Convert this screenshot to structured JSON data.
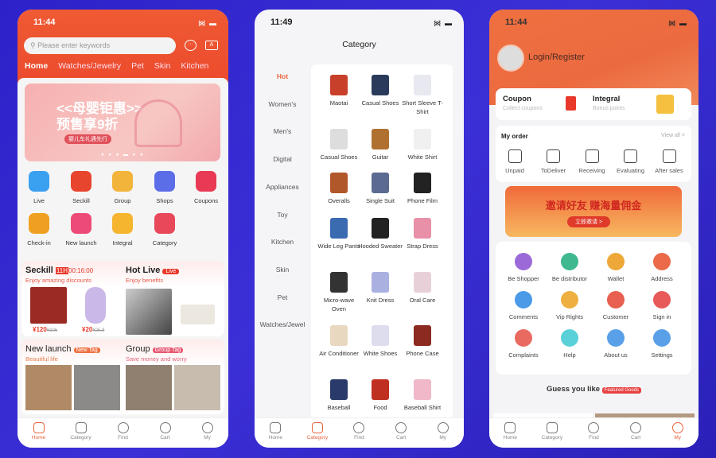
{
  "colors": {
    "accent": "#ee4f2f",
    "background": "#3025c9",
    "active_tab": "#e8643c"
  },
  "tabbar": [
    "Home",
    "Category",
    "Find",
    "Cart",
    "My"
  ],
  "home": {
    "time": "11:44",
    "search_placeholder": "Please enter keywords",
    "nav_tabs": [
      "Home",
      "Watches/Jewelry",
      "Pet",
      "Skin",
      "Kitchen"
    ],
    "banner_text": "<<母婴钜惠>>预售享9折",
    "banner_sub": "婴儿车礼遇先行",
    "shortcuts": [
      {
        "label": "Live",
        "icon": "live-tv-icon",
        "color": "#3aa0f0"
      },
      {
        "label": "Seckill",
        "icon": "alarm-clock-icon",
        "color": "#e8452f"
      },
      {
        "label": "Group",
        "icon": "group-icon",
        "color": "#f2b43a"
      },
      {
        "label": "Shops",
        "icon": "temple-icon",
        "color": "#5b6ee8"
      },
      {
        "label": "Coupons",
        "icon": "coupon-icon",
        "color": "#e83a55"
      },
      {
        "label": "Check-in",
        "icon": "checkin-icon",
        "color": "#f0a020"
      },
      {
        "label": "New launch",
        "icon": "hearts-icon",
        "color": "#ee4a78"
      },
      {
        "label": "Integral",
        "icon": "crown-icon",
        "color": "#f5b52e"
      },
      {
        "label": "Category",
        "icon": "clover-icon",
        "color": "#e8485a"
      }
    ],
    "seckill": {
      "title": "Seckill",
      "hour": "11H",
      "countdown": "00:16:00",
      "subtitle": "Enjoy amazing discounts",
      "prices": [
        {
          "now": "¥120",
          "was": "¥306"
        },
        {
          "now": "¥20",
          "was": "¥25.8"
        }
      ]
    },
    "hotlive": {
      "title": "Hot Live",
      "badge": "Live",
      "subtitle": "Enjoy benefits"
    },
    "newlaunch": {
      "title": "New launch",
      "badge": "New Tag",
      "subtitle": "Beautiful life"
    },
    "group": {
      "title": "Group",
      "badge": "Group Tag",
      "subtitle": "Save money and worry"
    }
  },
  "category": {
    "time": "11:49",
    "title": "Category",
    "sidebar": [
      "Hot",
      "Women's",
      "Men's",
      "Digital",
      "Appliances",
      "Toy",
      "Kitchen",
      "Skin",
      "Pet",
      "Watches/Jewel"
    ],
    "items": [
      "Maotai",
      "Casual Shoes",
      "Short Sleeve T-Shirt",
      "Casual Shoes",
      "Guitar",
      "White Shirt",
      "Overalls",
      "Single Suit",
      "Phone Film",
      "Wide Leg Pants",
      "Hooded Sweater",
      "Strap Dress",
      "Micro-wave Oven",
      "Knit Dress",
      "Oral Care",
      "Air Conditioner",
      "White Shoes",
      "Phone Case",
      "Baseball",
      "Food",
      "Baseball Shirt"
    ]
  },
  "my": {
    "time": "11:44",
    "login": "Login/Register",
    "coupon": {
      "title": "Coupon",
      "sub": "Collect coupons"
    },
    "integral": {
      "title": "Integral",
      "sub": "Bonus points"
    },
    "order": {
      "title": "My order",
      "view_all": "View all >",
      "items": [
        "Unpaid",
        "ToDeliver",
        "Receiving",
        "Evaluating",
        "After sales"
      ]
    },
    "banner_text": "邀请好友 赚海量佣金",
    "banner_button": "立即邀请 >",
    "services": [
      {
        "label": "Be Shopper",
        "color": "#9b6ad8"
      },
      {
        "label": "Be distributor",
        "color": "#3fb890"
      },
      {
        "label": "Wallet",
        "color": "#eea83a"
      },
      {
        "label": "Address",
        "color": "#ea6a4a"
      },
      {
        "label": "Comments",
        "color": "#4a9ae8"
      },
      {
        "label": "Vip Rights",
        "color": "#eeb040"
      },
      {
        "label": "Customer",
        "color": "#e86050"
      },
      {
        "label": "Sign in",
        "color": "#e85a5a"
      },
      {
        "label": "Complaints",
        "color": "#e86a60"
      },
      {
        "label": "Help",
        "color": "#5ad0d8"
      },
      {
        "label": "About us",
        "color": "#5aa0e8"
      },
      {
        "label": "Settings",
        "color": "#5aa0e8"
      }
    ],
    "guess": "Guess you like",
    "guess_badge": "Featured Goods"
  }
}
